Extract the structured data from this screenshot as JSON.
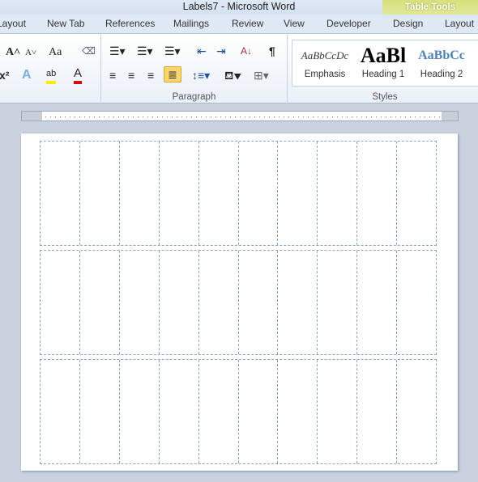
{
  "window": {
    "title": "Labels7  -  Microsoft Word",
    "context_tab": "Table Tools"
  },
  "tabs": [
    "Layout",
    "New Tab",
    "References",
    "Mailings",
    "Review",
    "View",
    "Developer",
    "Design",
    "Layout"
  ],
  "groups": {
    "paragraph": "Paragraph",
    "styles": "Styles"
  },
  "styles": [
    {
      "sample": "AaBbCcDc",
      "name": "Emphasis"
    },
    {
      "sample": "AaBl",
      "name": "Heading 1"
    },
    {
      "sample": "AaBbCc",
      "name": "Heading 2"
    }
  ],
  "icons": {
    "grow_font": "A^",
    "shrink_font": "Aˇ",
    "change_case": "Aa",
    "clear_format": "A⌫",
    "superscript": "x²",
    "text_effects": "A",
    "highlight": "ab",
    "font_color": "A",
    "pilcrow": "¶",
    "sort": "A↓"
  },
  "table": {
    "rows": 3,
    "columns": 10
  },
  "colors": {
    "accent": "#fbd66c",
    "table_tools": "#d7e07a",
    "gridline": "#8fa3c0"
  }
}
